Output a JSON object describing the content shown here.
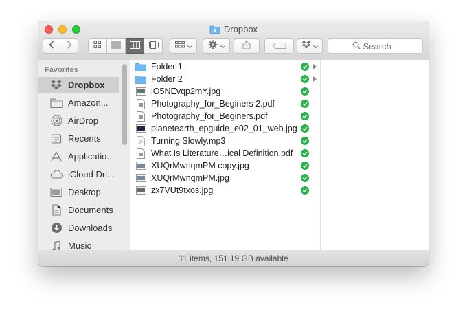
{
  "window": {
    "title": "Dropbox"
  },
  "toolbar": {
    "back_icon": "chevron-left-icon",
    "forward_icon": "chevron-right-icon",
    "view_modes": [
      "icon-view-icon",
      "list-view-icon",
      "column-view-icon",
      "coverflow-view-icon"
    ],
    "active_view": "column-view-icon",
    "arrange_icon": "arrange-grid-icon",
    "action_icon": "gear-icon",
    "share_icon": "share-icon",
    "tags_icon": "tag-icon",
    "dropbox_icon": "dropbox-icon",
    "search_placeholder": "Search"
  },
  "sidebar": {
    "header": "Favorites",
    "items": [
      {
        "label": "Dropbox",
        "icon": "dropbox-icon",
        "selected": true
      },
      {
        "label": "Amazon...",
        "icon": "folder-icon"
      },
      {
        "label": "AirDrop",
        "icon": "airdrop-icon"
      },
      {
        "label": "Recents",
        "icon": "recents-icon"
      },
      {
        "label": "Applicatio...",
        "icon": "applications-icon"
      },
      {
        "label": "iCloud Dri...",
        "icon": "icloud-icon"
      },
      {
        "label": "Desktop",
        "icon": "desktop-icon"
      },
      {
        "label": "Documents",
        "icon": "documents-icon"
      },
      {
        "label": "Downloads",
        "icon": "downloads-icon"
      },
      {
        "label": "Music",
        "icon": "music-icon"
      }
    ]
  },
  "files": [
    {
      "name": "Folder 1",
      "type": "folder",
      "synced": true,
      "has_children": true
    },
    {
      "name": "Folder 2",
      "type": "folder",
      "synced": true,
      "has_children": true
    },
    {
      "name": "iO5NEvqp2mY.jpg",
      "type": "image",
      "synced": true
    },
    {
      "name": "Photography_for_Beginers 2.pdf",
      "type": "pdf",
      "synced": true
    },
    {
      "name": "Photography_for_Beginers.pdf",
      "type": "pdf",
      "synced": true
    },
    {
      "name": "planetearth_epguide_e02_01_web.jpg",
      "type": "image",
      "synced": true
    },
    {
      "name": "Turning Slowly.mp3",
      "type": "audio",
      "synced": true
    },
    {
      "name": "What Is Literature…ical Definition.pdf",
      "type": "pdf",
      "synced": true
    },
    {
      "name": "XUQrMwnqmPM copy.jpg",
      "type": "image",
      "synced": true
    },
    {
      "name": "XUQrMwnqmPM.jpg",
      "type": "image",
      "synced": true
    },
    {
      "name": "zx7VUt9txos.jpg",
      "type": "image",
      "synced": true
    }
  ],
  "status": {
    "text": "11 items, 151.19 GB available"
  },
  "colors": {
    "sync_check": "#2ab24a",
    "folder": "#6db8f2",
    "selected_sidebar": "#d0d0d0"
  }
}
